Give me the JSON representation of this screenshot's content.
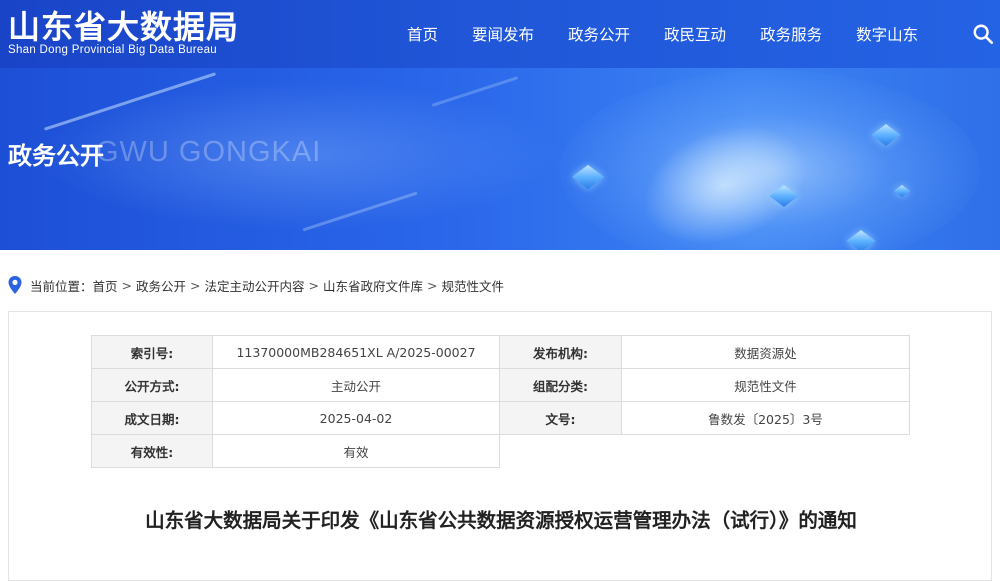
{
  "header": {
    "logo_cn": "山东省大数据局",
    "logo_en": "Shan Dong Provincial Big Data Bureau",
    "nav": [
      "首页",
      "要闻发布",
      "政务公开",
      "政民互动",
      "政务服务",
      "数字山东"
    ],
    "search_icon": "search-icon"
  },
  "banner": {
    "title": "政务公开",
    "pinyin": "GWU GONGKAI"
  },
  "breadcrumb": {
    "prefix": "当前位置：",
    "items": [
      "首页",
      "政务公开",
      "法定主动公开内容",
      "山东省政府文件库",
      "规范性文件"
    ],
    "separator": ">"
  },
  "meta": {
    "index_label": "索引号:",
    "index_value": "11370000MB284651XL A/2025-00027",
    "publisher_label": "发布机构:",
    "publisher_value": "数据资源处",
    "open_mode_label": "公开方式:",
    "open_mode_value": "主动公开",
    "category_label": "组配分类:",
    "category_value": "规范性文件",
    "date_label": "成文日期:",
    "date_value": "2025-04-02",
    "doc_no_label": "文号:",
    "doc_no_value": "鲁数发〔2025〕3号",
    "validity_label": "有效性:",
    "validity_value": "有效"
  },
  "document": {
    "title": "山东省大数据局关于印发《山东省公共数据资源授权运营管理办法（试行）》的通知"
  },
  "colors": {
    "header_blue": "#1d4fd6",
    "banner_light": "#3b82f3",
    "key_cell_bg": "#f4f4f4",
    "table_border": "#dcdcdc"
  }
}
